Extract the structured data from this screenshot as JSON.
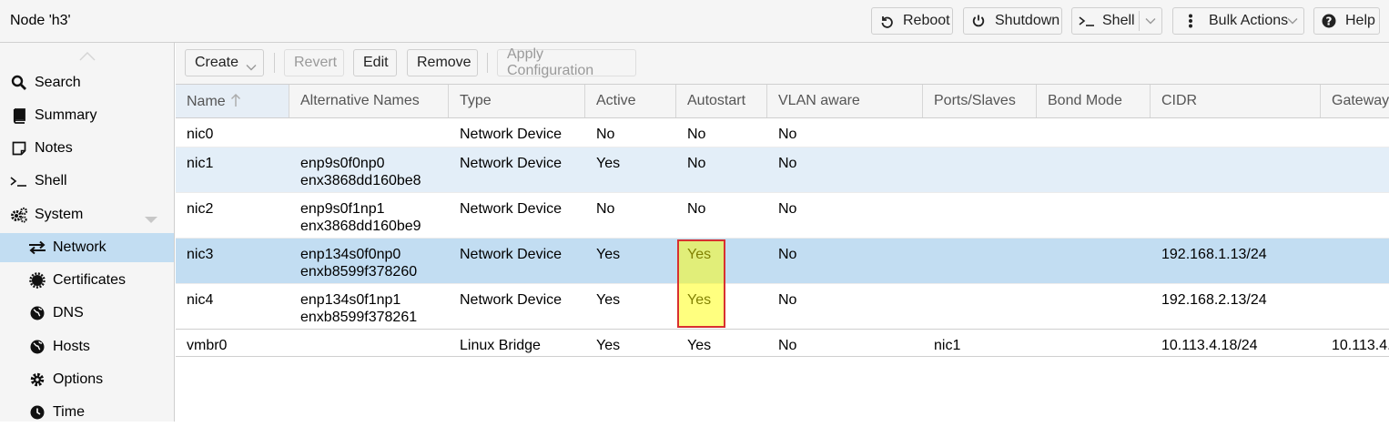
{
  "header": {
    "title": "Node 'h3'",
    "reboot": "Reboot",
    "shutdown": "Shutdown",
    "shell": "Shell",
    "bulk_actions": "Bulk Actions",
    "help": "Help"
  },
  "sidebar": {
    "items": [
      {
        "label": "Search",
        "icon": "search-icon"
      },
      {
        "label": "Summary",
        "icon": "book-icon"
      },
      {
        "label": "Notes",
        "icon": "note-icon"
      },
      {
        "label": "Shell",
        "icon": "terminal-icon"
      },
      {
        "label": "System",
        "icon": "gears-icon"
      },
      {
        "label": "Network",
        "icon": "exchange-icon"
      },
      {
        "label": "Certificates",
        "icon": "certificate-icon"
      },
      {
        "label": "DNS",
        "icon": "globe-icon"
      },
      {
        "label": "Hosts",
        "icon": "globe-icon"
      },
      {
        "label": "Options",
        "icon": "gear-icon"
      },
      {
        "label": "Time",
        "icon": "clock-icon"
      }
    ]
  },
  "toolbar": {
    "create": "Create",
    "revert": "Revert",
    "edit": "Edit",
    "remove": "Remove",
    "apply": "Apply Configuration"
  },
  "grid": {
    "columns": [
      "Name",
      "Alternative Names",
      "Type",
      "Active",
      "Autostart",
      "VLAN aware",
      "Ports/Slaves",
      "Bond Mode",
      "CIDR",
      "Gateway"
    ],
    "rows": [
      {
        "name": "nic0",
        "alt1": "",
        "alt2": "",
        "type": "Network Device",
        "active": "No",
        "autostart": "No",
        "vlan": "No",
        "ports": "",
        "bond": "",
        "cidr": "",
        "gateway": ""
      },
      {
        "name": "nic1",
        "alt1": "enp9s0f0np0",
        "alt2": "enx3868dd160be8",
        "type": "Network Device",
        "active": "Yes",
        "autostart": "No",
        "vlan": "No",
        "ports": "",
        "bond": "",
        "cidr": "",
        "gateway": ""
      },
      {
        "name": "nic2",
        "alt1": "enp9s0f1np1",
        "alt2": "enx3868dd160be9",
        "type": "Network Device",
        "active": "No",
        "autostart": "No",
        "vlan": "No",
        "ports": "",
        "bond": "",
        "cidr": "",
        "gateway": ""
      },
      {
        "name": "nic3",
        "alt1": "enp134s0f0np0",
        "alt2": "enxb8599f378260",
        "type": "Network Device",
        "active": "Yes",
        "autostart": "Yes",
        "vlan": "No",
        "ports": "",
        "bond": "",
        "cidr": "192.168.1.13/24",
        "gateway": ""
      },
      {
        "name": "nic4",
        "alt1": "enp134s0f1np1",
        "alt2": "enxb8599f378261",
        "type": "Network Device",
        "active": "Yes",
        "autostart": "Yes",
        "vlan": "No",
        "ports": "",
        "bond": "",
        "cidr": "192.168.2.13/24",
        "gateway": ""
      },
      {
        "name": "vmbr0",
        "alt1": "",
        "alt2": "",
        "type": "Linux Bridge",
        "active": "Yes",
        "autostart": "Yes",
        "vlan": "No",
        "ports": "nic1",
        "bond": "",
        "cidr": "10.113.4.18/24",
        "gateway": "10.113.4."
      }
    ]
  },
  "colors": {
    "selection": "#c2ddf2",
    "alt_row": "#e3eef8",
    "highlight_fill": "#ffff80",
    "highlight_border": "#d83030"
  }
}
